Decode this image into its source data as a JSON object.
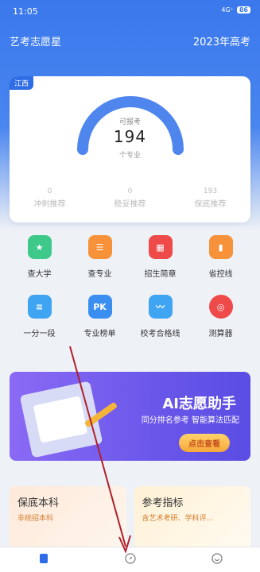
{
  "status": {
    "time": "11:05",
    "signal": "4G⁺",
    "battery": "86"
  },
  "app": {
    "title": "艺考志愿星",
    "year": "2023年高考"
  },
  "score": {
    "province": "江西",
    "label": "可报考",
    "value": "194",
    "unit": "个专业",
    "progress": 1.0,
    "stats": [
      {
        "num": "0",
        "label": "冲刺推荐"
      },
      {
        "num": "0",
        "label": "稳妥推荐"
      },
      {
        "num": "193",
        "label": "保底推荐"
      }
    ]
  },
  "menu": [
    {
      "label": "查大学",
      "icon": "school-book-icon",
      "color": "#3ec98a"
    },
    {
      "label": "查专业",
      "icon": "major-list-icon",
      "color": "#f7913a"
    },
    {
      "label": "招生简章",
      "icon": "brochure-icon",
      "color": "#ee4a4a"
    },
    {
      "label": "省控线",
      "icon": "bar-chart-icon",
      "color": "#f7913a"
    },
    {
      "label": "一分一段",
      "icon": "score-table-icon",
      "color": "#3fa4f2"
    },
    {
      "label": "专业榜单",
      "icon": "pk-ranking-icon",
      "color": "#3a8ef0"
    },
    {
      "label": "校考合格线",
      "icon": "trend-line-icon",
      "color": "#3fa4f2"
    },
    {
      "label": "测算器",
      "icon": "target-icon",
      "color": "#ee4a4a"
    }
  ],
  "banner": {
    "title": "AI志愿助手",
    "subtitle": "同分排名参考 智能算法匹配",
    "button": "点击查看"
  },
  "cards": [
    {
      "title": "保底本科",
      "subtitle": "非统招本科"
    },
    {
      "title": "参考指标",
      "subtitle": "含艺术考研、学科评..."
    }
  ],
  "tabs": [
    {
      "icon": "home-icon"
    },
    {
      "icon": "compass-icon"
    },
    {
      "icon": "smile-icon"
    }
  ]
}
